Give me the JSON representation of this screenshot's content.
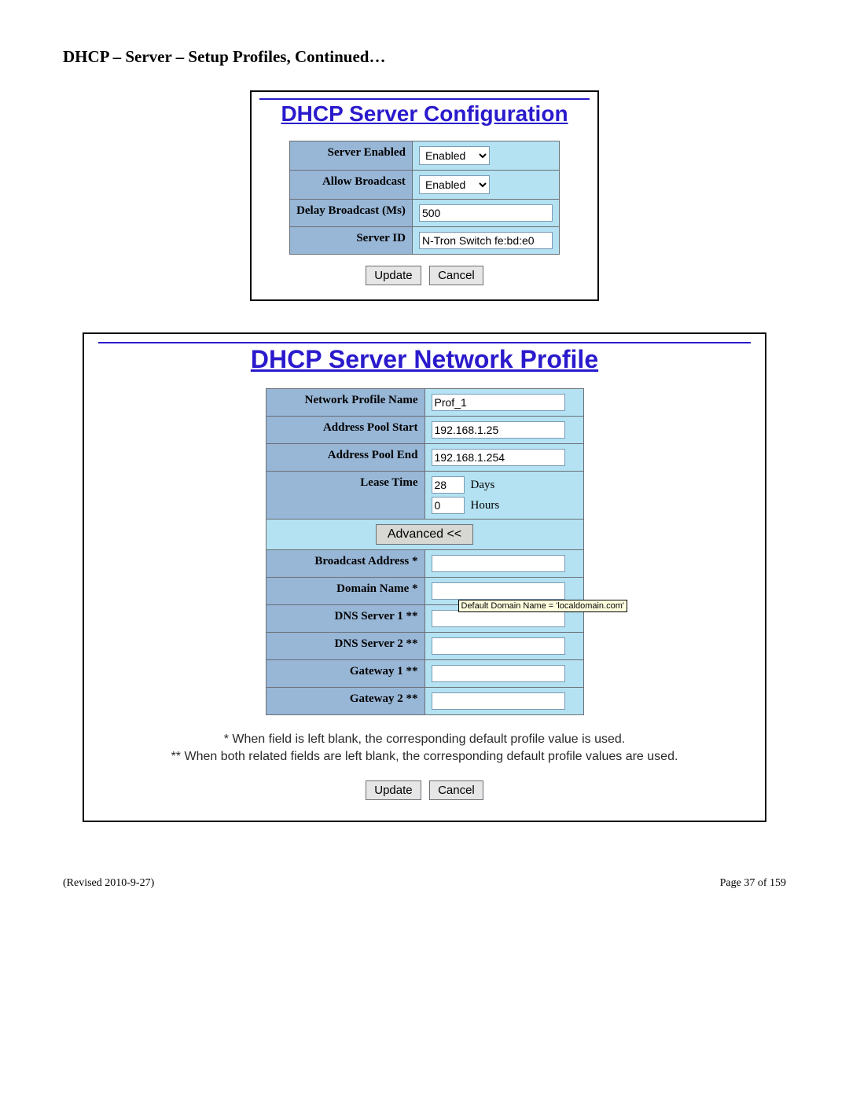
{
  "heading": "DHCP – Server – Setup Profiles, Continued…",
  "config_panel": {
    "title": "DHCP Server Configuration",
    "rows": {
      "server_enabled": {
        "label": "Server Enabled",
        "value": "Enabled"
      },
      "allow_broadcast": {
        "label": "Allow Broadcast",
        "value": "Enabled"
      },
      "delay_broadcast": {
        "label": "Delay Broadcast (Ms)",
        "value": "500"
      },
      "server_id": {
        "label": "Server ID",
        "value": "N-Tron Switch fe:bd:e0"
      }
    },
    "buttons": {
      "update": "Update",
      "cancel": "Cancel"
    }
  },
  "profile_panel": {
    "title": "DHCP Server Network Profile",
    "rows": {
      "profile_name": {
        "label": "Network Profile Name",
        "value": "Prof_1"
      },
      "pool_start": {
        "label": "Address Pool Start",
        "value": "192.168.1.25"
      },
      "pool_end": {
        "label": "Address Pool End",
        "value": "192.168.1.254"
      },
      "lease_time": {
        "label": "Lease Time",
        "days": "28",
        "days_unit": "Days",
        "hours": "0",
        "hours_unit": "Hours"
      },
      "advanced_btn": "Advanced  <<",
      "broadcast_addr": {
        "label": "Broadcast Address *",
        "value": ""
      },
      "domain_name": {
        "label": "Domain Name *",
        "value": "",
        "tooltip": "Default Domain Name = 'localdomain.com'"
      },
      "dns1": {
        "label": "DNS Server 1 **",
        "value": ""
      },
      "dns2": {
        "label": "DNS Server 2 **",
        "value": ""
      },
      "gateway1": {
        "label": "Gateway 1 **",
        "value": ""
      },
      "gateway2": {
        "label": "Gateway 2 **",
        "value": ""
      }
    },
    "note1": "* When field is left blank, the corresponding default profile value is used.",
    "note2": "** When both related fields are left blank, the corresponding default profile values are used.",
    "buttons": {
      "update": "Update",
      "cancel": "Cancel"
    }
  },
  "footer": {
    "revised": "(Revised 2010-9-27)",
    "page": "Page 37 of 159"
  }
}
